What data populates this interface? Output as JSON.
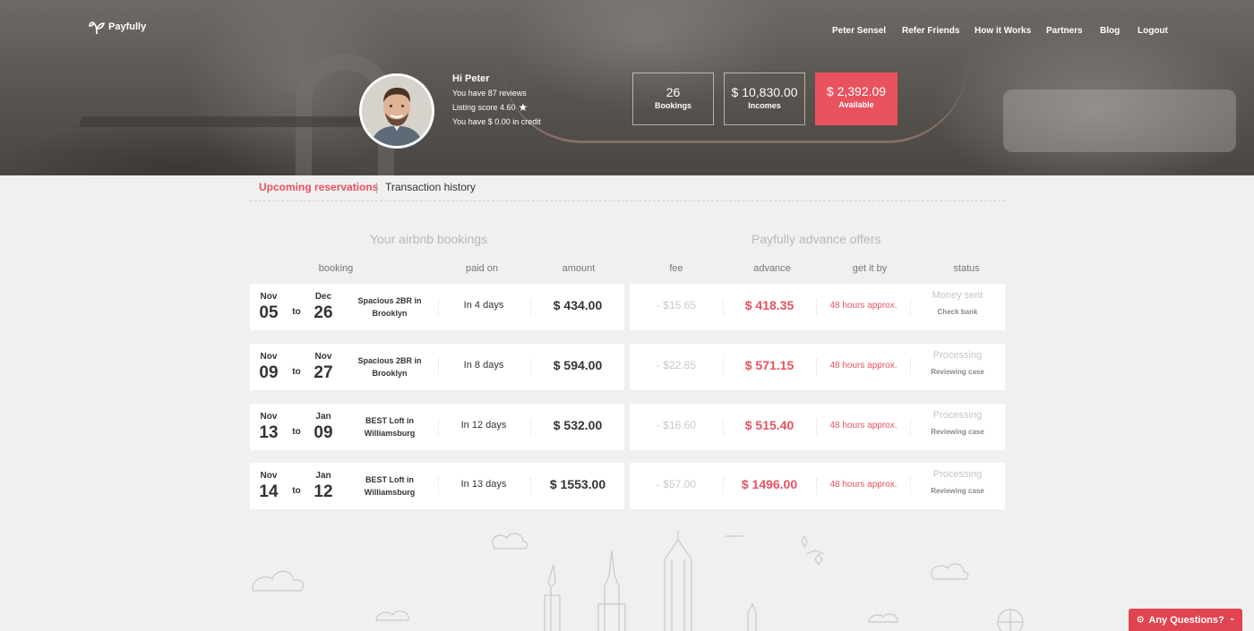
{
  "brand": {
    "name": "Payfully"
  },
  "nav": {
    "items": [
      "Peter Sensel",
      "Refer Friends",
      "How it Works",
      "Partners",
      "Blog",
      "Logout"
    ]
  },
  "profile": {
    "greeting": "Hi Peter",
    "reviews": "You have 87 reviews",
    "listing_score": "Listing score 4.60",
    "credit": "You have $ 0.00 in credit"
  },
  "stats": [
    {
      "value": "26",
      "label": "Bookings"
    },
    {
      "value": "$ 10,830.00",
      "label": "Incomes"
    },
    {
      "value": "$ 2,392.09",
      "label": "Available"
    }
  ],
  "tabs": [
    "Upcoming reservations",
    "Transaction history"
  ],
  "sections": {
    "bookings": "Your airbnb bookings",
    "offers": "Payfully advance offers"
  },
  "columns": [
    "booking",
    "paid on",
    "amount",
    "fee",
    "advance",
    "get it by",
    "status"
  ],
  "rows": [
    {
      "from_month": "Nov",
      "from_day": "05",
      "to_label": "to",
      "to_month": "Dec",
      "to_day": "26",
      "listing": "Spacious 2BR in Brooklyn",
      "paid_on": "In 4 days",
      "amount": "$ 434.00",
      "fee": "- $15.65",
      "advance": "$ 418.35",
      "get_by": "48 hours approx.",
      "status": "Money sent",
      "status_sub": "Check bank"
    },
    {
      "from_month": "Nov",
      "from_day": "09",
      "to_label": "to",
      "to_month": "Nov",
      "to_day": "27",
      "listing": "Spacious 2BR in Brooklyn",
      "paid_on": "In 8 days",
      "amount": "$ 594.00",
      "fee": "- $22.85",
      "advance": "$ 571.15",
      "get_by": "48 hours approx.",
      "status": "Processing",
      "status_sub": "Reviewing case"
    },
    {
      "from_month": "Nov",
      "from_day": "13",
      "to_label": "to",
      "to_month": "Jan",
      "to_day": "09",
      "listing": "BEST Loft in Williamsburg",
      "paid_on": "In 12 days",
      "amount": "$ 532.00",
      "fee": "- $16.60",
      "advance": "$ 515.40",
      "get_by": "48 hours approx.",
      "status": "Processing",
      "status_sub": "Reviewing case"
    },
    {
      "from_month": "Nov",
      "from_day": "14",
      "to_label": "to",
      "to_month": "Jan",
      "to_day": "12",
      "listing": "BEST Loft in Williamsburg",
      "paid_on": "In 13 days",
      "amount": "$ 1553.00",
      "fee": "- $57.00",
      "advance": "$ 1496.00",
      "get_by": "48 hours approx.",
      "status": "Processing",
      "status_sub": "Reviewing case"
    }
  ],
  "help": {
    "label": "Any Questions?",
    "icon": "help-circle-icon",
    "chevron": "chevron-icon"
  },
  "colors": {
    "accent": "#e8525f",
    "background": "#f0f0f0"
  }
}
